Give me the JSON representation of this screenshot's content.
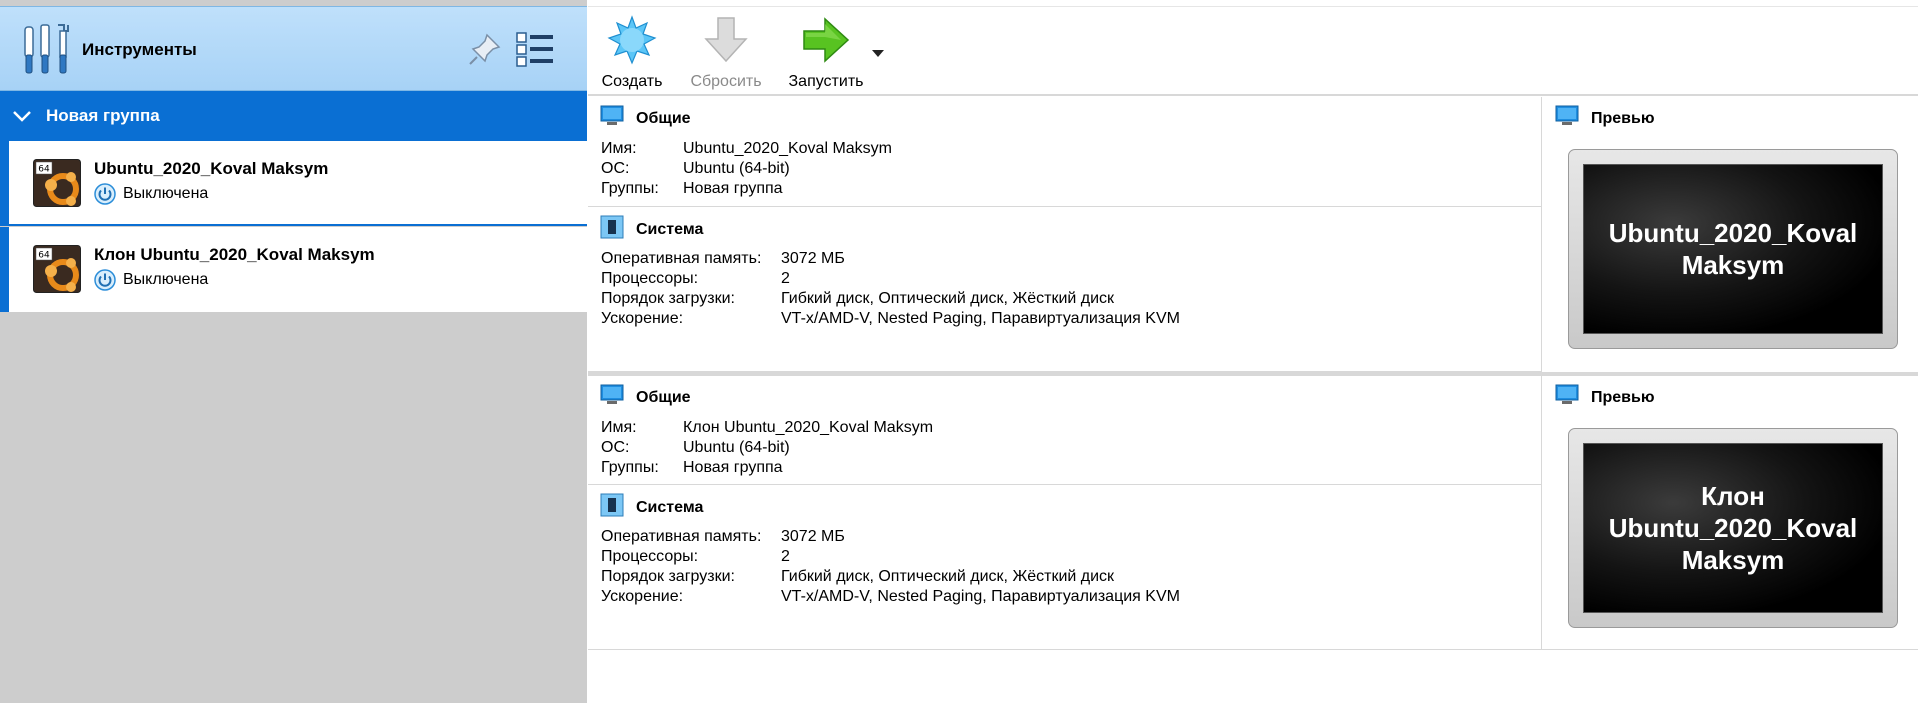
{
  "tools": {
    "title": "Инструменты"
  },
  "group": {
    "label": "Новая группа"
  },
  "vm_list": [
    {
      "name": "Ubuntu_2020_Koval Maksym",
      "state": "Выключена",
      "badge": "64"
    },
    {
      "name": "Клон Ubuntu_2020_Koval Maksym",
      "state": "Выключена",
      "badge": "64"
    }
  ],
  "toolbar": {
    "create_label": "Создать",
    "reset_label": "Сбросить",
    "start_label": "Запустить"
  },
  "details": [
    {
      "general_title": "Общие",
      "general_rows": [
        {
          "key": "Имя:",
          "value": "Ubuntu_2020_Koval Maksym"
        },
        {
          "key": "ОС:",
          "value": "Ubuntu (64-bit)"
        },
        {
          "key": "Группы:",
          "value": "Новая группа"
        }
      ],
      "system_title": "Система",
      "system_rows": [
        {
          "key": "Оперативная память:",
          "value": "3072 МБ"
        },
        {
          "key": "Процессоры:",
          "value": "2"
        },
        {
          "key": "Порядок загрузки:",
          "value": "Гибкий диск, Оптический диск, Жёсткий диск"
        },
        {
          "key": "Ускорение:",
          "value": "VT-x/AMD-V, Nested Paging, Паравиртуализация KVM"
        }
      ],
      "preview_title": "Превью",
      "preview_text": "Ubuntu_2020_Koval Maksym"
    },
    {
      "general_title": "Общие",
      "general_rows": [
        {
          "key": "Имя:",
          "value": "Клон Ubuntu_2020_Koval Maksym"
        },
        {
          "key": "ОС:",
          "value": "Ubuntu (64-bit)"
        },
        {
          "key": "Группы:",
          "value": "Новая группа"
        }
      ],
      "system_title": "Система",
      "system_rows": [
        {
          "key": "Оперативная память:",
          "value": "3072 МБ"
        },
        {
          "key": "Процессоры:",
          "value": "2"
        },
        {
          "key": "Порядок загрузки:",
          "value": "Гибкий диск, Оптический диск, Жёсткий диск"
        },
        {
          "key": "Ускорение:",
          "value": "VT-x/AMD-V, Nested Paging, Паравиртуализация KVM"
        }
      ],
      "preview_title": "Превью",
      "preview_text": "Клон Ubuntu_2020_Koval Maksym"
    }
  ],
  "colors": {
    "selection": "#0a6fd3",
    "tools_header": "#a7d2f6",
    "left_background": "#cdcdcd",
    "start_arrow": "#58c321",
    "create_star": "#5cc6f7"
  },
  "icons": {
    "tools": "tools-icon",
    "pin": "pin-icon",
    "list": "list-view-icon",
    "vm_os": "ubuntu-64-icon",
    "power": "power-icon",
    "create": "create-star-icon",
    "reset": "reset-arrow-down-icon",
    "start": "start-arrow-right-icon",
    "general": "monitor-icon",
    "system": "chip-icon",
    "preview": "monitor-icon"
  }
}
